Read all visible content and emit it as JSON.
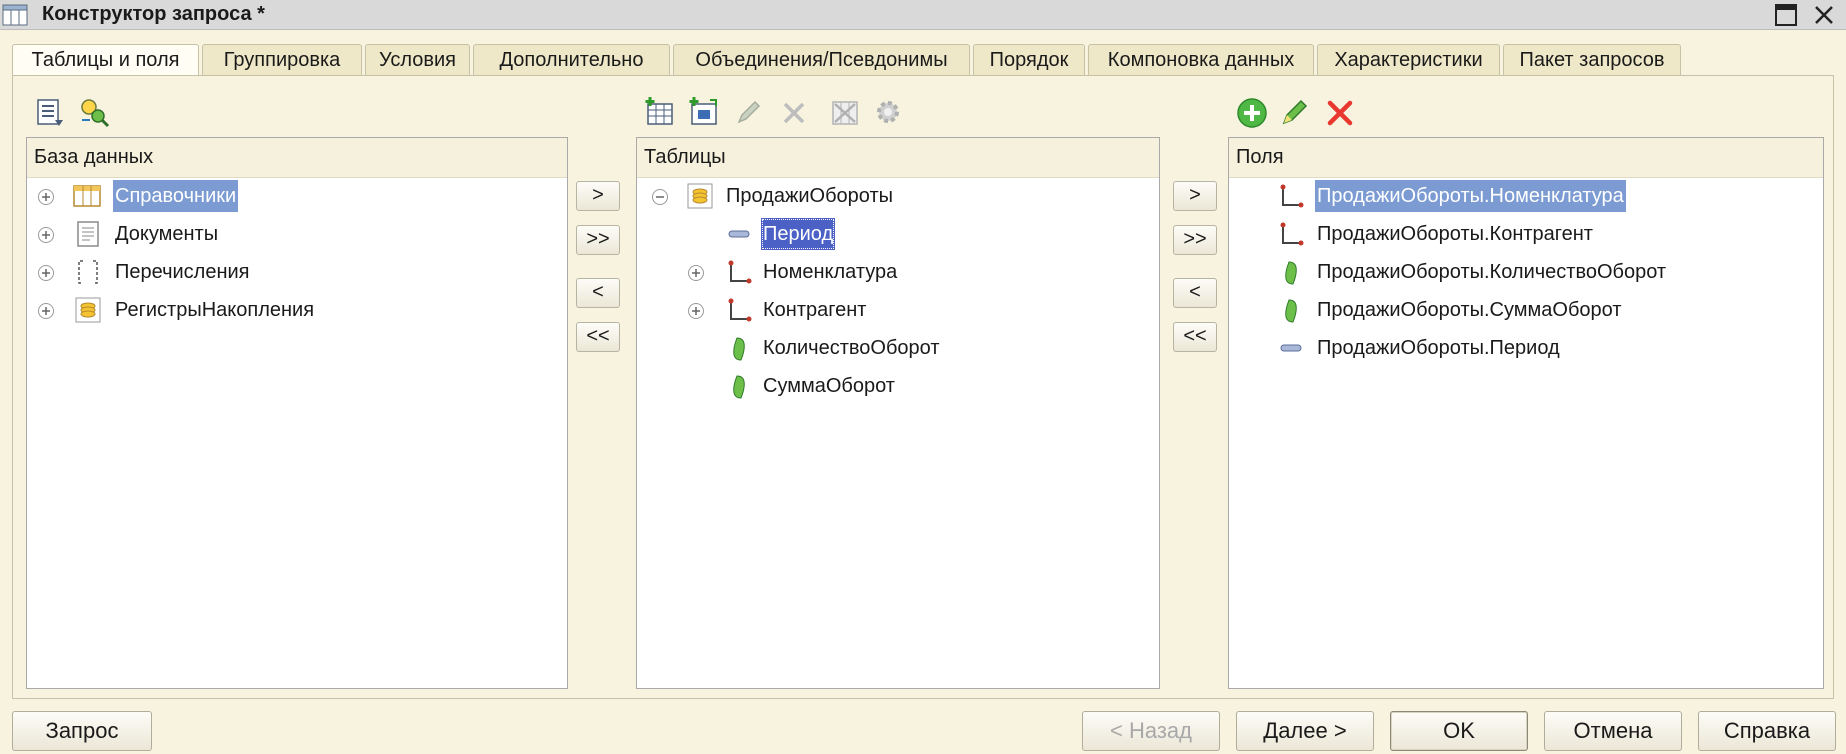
{
  "window": {
    "title": "Конструктор запроса *"
  },
  "tabs": [
    {
      "label": "Таблицы и поля",
      "active": true
    },
    {
      "label": "Группировка"
    },
    {
      "label": "Условия"
    },
    {
      "label": "Дополнительно"
    },
    {
      "label": "Объединения/Псевдонимы"
    },
    {
      "label": "Порядок"
    },
    {
      "label": "Компоновка данных"
    },
    {
      "label": "Характеристики"
    },
    {
      "label": "Пакет запросов"
    }
  ],
  "database_panel": {
    "header": "База данных",
    "items": [
      {
        "label": "Справочники",
        "icon": "catalog-icon",
        "selected": true
      },
      {
        "label": "Документы",
        "icon": "document-icon"
      },
      {
        "label": "Перечисления",
        "icon": "enum-icon"
      },
      {
        "label": "РегистрыНакопления",
        "icon": "accumulation-register-icon"
      }
    ]
  },
  "tables_panel": {
    "header": "Таблицы",
    "root": {
      "label": "ПродажиОбороты",
      "icon": "accumulation-register-icon",
      "expanded": true
    },
    "children": [
      {
        "label": "Период",
        "icon": "period-icon",
        "selected": true
      },
      {
        "label": "Номенклатура",
        "icon": "dimension-icon",
        "expandable": true
      },
      {
        "label": "Контрагент",
        "icon": "dimension-icon",
        "expandable": true
      },
      {
        "label": "КоличествоОборот",
        "icon": "resource-icon"
      },
      {
        "label": "СуммаОборот",
        "icon": "resource-icon"
      }
    ]
  },
  "fields_panel": {
    "header": "Поля",
    "items": [
      {
        "label": "ПродажиОбороты.Номенклатура",
        "icon": "dimension-icon",
        "selected": true
      },
      {
        "label": "ПродажиОбороты.Контрагент",
        "icon": "dimension-icon"
      },
      {
        "label": "ПродажиОбороты.КоличествоОборот",
        "icon": "resource-icon"
      },
      {
        "label": "ПродажиОбороты.СуммаОборот",
        "icon": "resource-icon"
      },
      {
        "label": "ПродажиОбороты.Период",
        "icon": "period-icon"
      }
    ]
  },
  "move_buttons": {
    "add": ">",
    "add_all": ">>",
    "remove": "<",
    "remove_all": "<<"
  },
  "footer": {
    "query": "Запрос",
    "back": "< Назад",
    "next": "Далее >",
    "ok": "OK",
    "cancel": "Отмена",
    "help": "Справка"
  },
  "colors": {
    "background": "#f7f3df",
    "selection": "#7b9bd2",
    "selection_focused": "#4b61c6",
    "delete_red": "#e8382f",
    "add_green": "#3faa35"
  }
}
